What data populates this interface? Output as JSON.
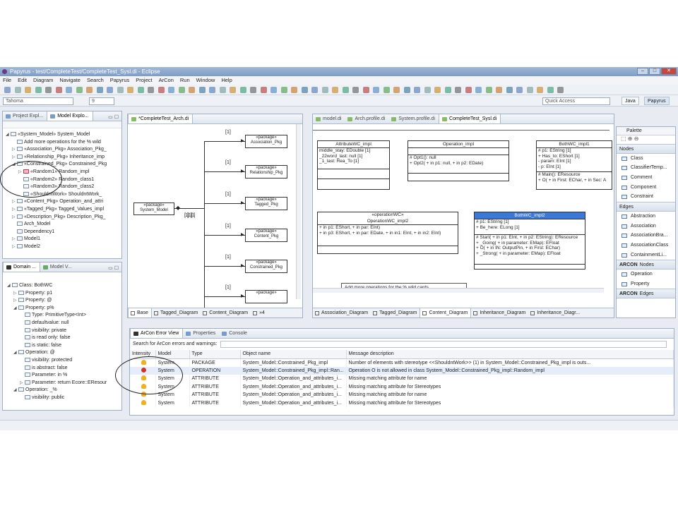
{
  "window": {
    "title": "Papyrus - test/CompleteTest/CompleteTest_Sysl.di - Eclipse",
    "controls": [
      "–",
      "□",
      "✕"
    ]
  },
  "menu": [
    "File",
    "Edit",
    "Diagram",
    "Navigate",
    "Search",
    "Papyrus",
    "Project",
    "ArCon",
    "Run",
    "Window",
    "Help"
  ],
  "toolbar2": {
    "font": "Tahoma",
    "size": "9",
    "quick_access": "Quick Access",
    "persp_java": "Java",
    "persp_papyrus": "Papyrus"
  },
  "model_explorer": {
    "tab1": "Project Expl...",
    "tab2": "Model Explo...",
    "items": [
      {
        "label": "«System_Model» System_Model",
        "indent": 0,
        "tw": "◢"
      },
      {
        "label": "Add more operations for the % wild",
        "indent": 1,
        "tw": ""
      },
      {
        "label": "«Association_Pkg» Association_Pkg_",
        "indent": 1,
        "tw": "▷"
      },
      {
        "label": "«Relationship_Pkg» Inheritance_imp",
        "indent": 1,
        "tw": "▷"
      },
      {
        "label": "«Constrained_Pkg» Constrained_Pkg",
        "indent": 1,
        "tw": "◢"
      },
      {
        "label": "«Random1» Random_impl",
        "indent": 2,
        "tw": "▷",
        "red": true
      },
      {
        "label": "«Random2» Random_class1",
        "indent": 2,
        "tw": ""
      },
      {
        "label": "«Random3» Random_class2",
        "indent": 2,
        "tw": ""
      },
      {
        "label": "«ShouldntWork» ShouldntWork_",
        "indent": 2,
        "tw": ""
      },
      {
        "label": "«Content_Pkg» Operation_and_attri",
        "indent": 1,
        "tw": "▷"
      },
      {
        "label": "«Tagged_Pkg» Tagged_Values_impl",
        "indent": 1,
        "tw": "▷"
      },
      {
        "label": "«Description_Pkg» Description_Pkg_",
        "indent": 1,
        "tw": "▷"
      },
      {
        "label": "Arch_Model",
        "indent": 1,
        "tw": ""
      },
      {
        "label": "Dependency1",
        "indent": 1,
        "tw": ""
      },
      {
        "label": "Model1",
        "indent": 1,
        "tw": "▷"
      },
      {
        "label": "Model2",
        "indent": 1,
        "tw": "▷"
      }
    ]
  },
  "domain": {
    "tab1": "Domain ...",
    "tab2": "Model V...",
    "items": [
      {
        "label": "Class: BothWC",
        "indent": 0,
        "tw": "◢"
      },
      {
        "label": "Property: p1",
        "indent": 1,
        "tw": "▷"
      },
      {
        "label": "Property: @",
        "indent": 1,
        "tw": "▷"
      },
      {
        "label": "Property: p%",
        "indent": 1,
        "tw": "◢"
      },
      {
        "label": "Type: PrimitiveType<Int>",
        "indent": 2,
        "tw": ""
      },
      {
        "label": "defaultvalue: null",
        "indent": 2,
        "tw": ""
      },
      {
        "label": "visibility: private",
        "indent": 2,
        "tw": ""
      },
      {
        "label": "is read only: false",
        "indent": 2,
        "tw": ""
      },
      {
        "label": "is static: false",
        "indent": 2,
        "tw": ""
      },
      {
        "label": "Operation: @",
        "indent": 1,
        "tw": "◢"
      },
      {
        "label": "visibility: protected",
        "indent": 2,
        "tw": ""
      },
      {
        "label": "is abstract: false",
        "indent": 2,
        "tw": ""
      },
      {
        "label": "Parameter: in %",
        "indent": 2,
        "tw": ""
      },
      {
        "label": "Parameter: return Ecore::EResour",
        "indent": 2,
        "tw": "▷"
      },
      {
        "label": "Operation: _%",
        "indent": 1,
        "tw": "◢"
      },
      {
        "label": "visibility: public",
        "indent": 2,
        "tw": ""
      }
    ]
  },
  "arch_editor": {
    "tab": "*CompleteTest_Arch.di",
    "system_box": "«package»\nSystem_Model",
    "packages": [
      "«package»\nAssociation_Pkg",
      "«package»\nRelationship_Pkg",
      "«package»\nTagged_Pkg",
      "«package»\nContent_Pkg",
      "«package»\nConstrained_Pkg",
      "«package»"
    ],
    "mult": "[1]",
    "bottom_tabs": [
      "Base",
      "Tagged_Diagram",
      "Content_Diagram",
      "»4"
    ]
  },
  "sysl_editor": {
    "tabs": [
      "model.di",
      "Arch.profile.di",
      "System.profile.di",
      "CompleteTest_Sysl.di"
    ],
    "classes": {
      "attr_wc": {
        "name": "AttributeWC_impl",
        "attrs": [
          "middle_stay: EDouble [1]",
          "_22word_last: null [1]",
          "_1_last: Rea_To [1]"
        ]
      },
      "op_impl": {
        "name": "Operation_impl",
        "ops": [
          "# Opt1(): null",
          "+ Opt2( + in p1: null, + in p2: EDate)"
        ]
      },
      "bothwc1": {
        "name": "BothWC_impl1",
        "attrs": [
          "# p1: EString [1]",
          "+ Has_to: EShort [1]",
          "- param: EInt [1]",
          "- p: EInt [1]"
        ],
        "ops": [
          "# Main(): EResource",
          "+ O( + in First: EChar, + in Sec: A"
        ]
      },
      "opwc2": {
        "stereo": "«operationWC»",
        "name": "OperationWC_impl2",
        "ops": [
          "+ in p1: EShort, + in par: EInt)",
          "+ in p3: EShort, + in par: EDate, + in in1: EInt, + in in2: EInt)"
        ]
      },
      "bothwc2": {
        "name": "BothWC_impl2",
        "attrs": [
          "# p1: EString [1]",
          "+ Be_here: ELong [1]"
        ],
        "ops": [
          "# Start( + in p1: EInt, + in p2: EString): EResource",
          "+ _Going( + in parameter: EMap): EFloat",
          "+ O( + in IN: OutputPin, + in First: EChar)",
          "+ _Strong( + in parameter: EMap): EFloat"
        ]
      }
    },
    "comment": "Add more operations for the % wild cards.",
    "bottom_tabs": [
      "Association_Diagram",
      "Tagged_Diagram",
      "Content_Diagram",
      "Inheritance_Diagram",
      "Inheritance_Diagr..."
    ]
  },
  "palette": {
    "title": "Palette",
    "sections": [
      {
        "name": "Nodes",
        "items": [
          "Class",
          "ClassifierTemp...",
          "Comment",
          "Component",
          "Constraint"
        ]
      },
      {
        "name": "Edges",
        "items": [
          "Abstraction",
          "Association",
          "AssociationBra...",
          "AssociationClass",
          "ContainmentLi..."
        ]
      },
      {
        "name": "Nodes",
        "items": [
          "Operation",
          "Property"
        ],
        "arcon": true
      },
      {
        "name": "Edges",
        "items": [],
        "arcon": true
      }
    ]
  },
  "error_view": {
    "tabs": [
      "ArCon Error View",
      "Properties",
      "Console"
    ],
    "search_label": "Search for ArCon errors and warnings:",
    "columns": [
      "Intensity",
      "Model",
      "Type",
      "Object name",
      "Message description"
    ],
    "rows": [
      {
        "sev": "warn",
        "model": "System",
        "type": "PACKAGE",
        "obj": "System_Model::Constrained_Pkg_impl",
        "msg": "Number of elements with stereotype <<ShouldntWork>> (1) in System_Model::Constrained_Pkg_impl is outs..."
      },
      {
        "sev": "err",
        "model": "System",
        "type": "OPERATION",
        "obj": "System_Model::Constrained_Pkg_impl::Ran...",
        "msg": "Operation O is not allowed in class System_Model::Constrained_Pkg_impl::Random_impl"
      },
      {
        "sev": "warn",
        "model": "System",
        "type": "ATTRIBUTE",
        "obj": "System_Model::Operation_and_attributes_i...",
        "msg": "Missing matching attribute for name"
      },
      {
        "sev": "warn",
        "model": "System",
        "type": "ATTRIBUTE",
        "obj": "System_Model::Operation_and_attributes_i...",
        "msg": "Missing matching attribute for Stereotypes"
      },
      {
        "sev": "warn",
        "model": "System",
        "type": "ATTRIBUTE",
        "obj": "System_Model::Operation_and_attributes_i...",
        "msg": "Missing matching attribute for name"
      },
      {
        "sev": "warn",
        "model": "System",
        "type": "ATTRIBUTE",
        "obj": "System_Model::Operation_and_attributes_i...",
        "msg": "Missing matching attribute for Stereotypes"
      }
    ]
  }
}
